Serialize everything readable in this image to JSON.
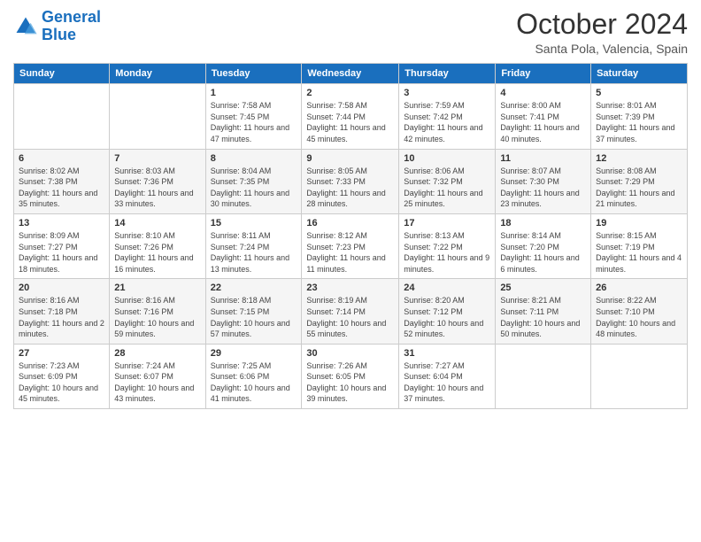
{
  "logo": {
    "text_general": "General",
    "text_blue": "Blue"
  },
  "header": {
    "month": "October 2024",
    "location": "Santa Pola, Valencia, Spain"
  },
  "days_of_week": [
    "Sunday",
    "Monday",
    "Tuesday",
    "Wednesday",
    "Thursday",
    "Friday",
    "Saturday"
  ],
  "weeks": [
    [
      {
        "day": "",
        "sunrise": "",
        "sunset": "",
        "daylight": ""
      },
      {
        "day": "",
        "sunrise": "",
        "sunset": "",
        "daylight": ""
      },
      {
        "day": "1",
        "sunrise": "Sunrise: 7:58 AM",
        "sunset": "Sunset: 7:45 PM",
        "daylight": "Daylight: 11 hours and 47 minutes."
      },
      {
        "day": "2",
        "sunrise": "Sunrise: 7:58 AM",
        "sunset": "Sunset: 7:44 PM",
        "daylight": "Daylight: 11 hours and 45 minutes."
      },
      {
        "day": "3",
        "sunrise": "Sunrise: 7:59 AM",
        "sunset": "Sunset: 7:42 PM",
        "daylight": "Daylight: 11 hours and 42 minutes."
      },
      {
        "day": "4",
        "sunrise": "Sunrise: 8:00 AM",
        "sunset": "Sunset: 7:41 PM",
        "daylight": "Daylight: 11 hours and 40 minutes."
      },
      {
        "day": "5",
        "sunrise": "Sunrise: 8:01 AM",
        "sunset": "Sunset: 7:39 PM",
        "daylight": "Daylight: 11 hours and 37 minutes."
      }
    ],
    [
      {
        "day": "6",
        "sunrise": "Sunrise: 8:02 AM",
        "sunset": "Sunset: 7:38 PM",
        "daylight": "Daylight: 11 hours and 35 minutes."
      },
      {
        "day": "7",
        "sunrise": "Sunrise: 8:03 AM",
        "sunset": "Sunset: 7:36 PM",
        "daylight": "Daylight: 11 hours and 33 minutes."
      },
      {
        "day": "8",
        "sunrise": "Sunrise: 8:04 AM",
        "sunset": "Sunset: 7:35 PM",
        "daylight": "Daylight: 11 hours and 30 minutes."
      },
      {
        "day": "9",
        "sunrise": "Sunrise: 8:05 AM",
        "sunset": "Sunset: 7:33 PM",
        "daylight": "Daylight: 11 hours and 28 minutes."
      },
      {
        "day": "10",
        "sunrise": "Sunrise: 8:06 AM",
        "sunset": "Sunset: 7:32 PM",
        "daylight": "Daylight: 11 hours and 25 minutes."
      },
      {
        "day": "11",
        "sunrise": "Sunrise: 8:07 AM",
        "sunset": "Sunset: 7:30 PM",
        "daylight": "Daylight: 11 hours and 23 minutes."
      },
      {
        "day": "12",
        "sunrise": "Sunrise: 8:08 AM",
        "sunset": "Sunset: 7:29 PM",
        "daylight": "Daylight: 11 hours and 21 minutes."
      }
    ],
    [
      {
        "day": "13",
        "sunrise": "Sunrise: 8:09 AM",
        "sunset": "Sunset: 7:27 PM",
        "daylight": "Daylight: 11 hours and 18 minutes."
      },
      {
        "day": "14",
        "sunrise": "Sunrise: 8:10 AM",
        "sunset": "Sunset: 7:26 PM",
        "daylight": "Daylight: 11 hours and 16 minutes."
      },
      {
        "day": "15",
        "sunrise": "Sunrise: 8:11 AM",
        "sunset": "Sunset: 7:24 PM",
        "daylight": "Daylight: 11 hours and 13 minutes."
      },
      {
        "day": "16",
        "sunrise": "Sunrise: 8:12 AM",
        "sunset": "Sunset: 7:23 PM",
        "daylight": "Daylight: 11 hours and 11 minutes."
      },
      {
        "day": "17",
        "sunrise": "Sunrise: 8:13 AM",
        "sunset": "Sunset: 7:22 PM",
        "daylight": "Daylight: 11 hours and 9 minutes."
      },
      {
        "day": "18",
        "sunrise": "Sunrise: 8:14 AM",
        "sunset": "Sunset: 7:20 PM",
        "daylight": "Daylight: 11 hours and 6 minutes."
      },
      {
        "day": "19",
        "sunrise": "Sunrise: 8:15 AM",
        "sunset": "Sunset: 7:19 PM",
        "daylight": "Daylight: 11 hours and 4 minutes."
      }
    ],
    [
      {
        "day": "20",
        "sunrise": "Sunrise: 8:16 AM",
        "sunset": "Sunset: 7:18 PM",
        "daylight": "Daylight: 11 hours and 2 minutes."
      },
      {
        "day": "21",
        "sunrise": "Sunrise: 8:16 AM",
        "sunset": "Sunset: 7:16 PM",
        "daylight": "Daylight: 10 hours and 59 minutes."
      },
      {
        "day": "22",
        "sunrise": "Sunrise: 8:18 AM",
        "sunset": "Sunset: 7:15 PM",
        "daylight": "Daylight: 10 hours and 57 minutes."
      },
      {
        "day": "23",
        "sunrise": "Sunrise: 8:19 AM",
        "sunset": "Sunset: 7:14 PM",
        "daylight": "Daylight: 10 hours and 55 minutes."
      },
      {
        "day": "24",
        "sunrise": "Sunrise: 8:20 AM",
        "sunset": "Sunset: 7:12 PM",
        "daylight": "Daylight: 10 hours and 52 minutes."
      },
      {
        "day": "25",
        "sunrise": "Sunrise: 8:21 AM",
        "sunset": "Sunset: 7:11 PM",
        "daylight": "Daylight: 10 hours and 50 minutes."
      },
      {
        "day": "26",
        "sunrise": "Sunrise: 8:22 AM",
        "sunset": "Sunset: 7:10 PM",
        "daylight": "Daylight: 10 hours and 48 minutes."
      }
    ],
    [
      {
        "day": "27",
        "sunrise": "Sunrise: 7:23 AM",
        "sunset": "Sunset: 6:09 PM",
        "daylight": "Daylight: 10 hours and 45 minutes."
      },
      {
        "day": "28",
        "sunrise": "Sunrise: 7:24 AM",
        "sunset": "Sunset: 6:07 PM",
        "daylight": "Daylight: 10 hours and 43 minutes."
      },
      {
        "day": "29",
        "sunrise": "Sunrise: 7:25 AM",
        "sunset": "Sunset: 6:06 PM",
        "daylight": "Daylight: 10 hours and 41 minutes."
      },
      {
        "day": "30",
        "sunrise": "Sunrise: 7:26 AM",
        "sunset": "Sunset: 6:05 PM",
        "daylight": "Daylight: 10 hours and 39 minutes."
      },
      {
        "day": "31",
        "sunrise": "Sunrise: 7:27 AM",
        "sunset": "Sunset: 6:04 PM",
        "daylight": "Daylight: 10 hours and 37 minutes."
      },
      {
        "day": "",
        "sunrise": "",
        "sunset": "",
        "daylight": ""
      },
      {
        "day": "",
        "sunrise": "",
        "sunset": "",
        "daylight": ""
      }
    ]
  ]
}
